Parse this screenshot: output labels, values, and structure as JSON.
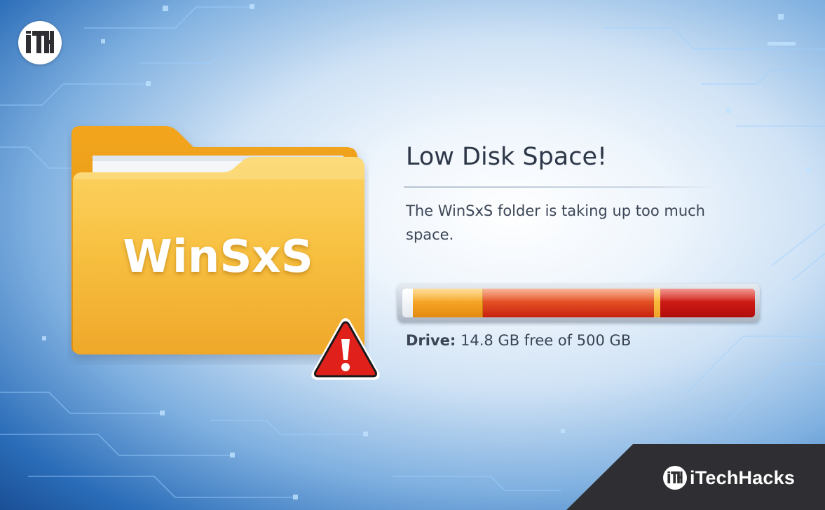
{
  "logo": {
    "mark_text": "iTH"
  },
  "folder": {
    "label": "WinSxS",
    "icon": "folder-icon",
    "warning_icon": "warning-triangle-icon"
  },
  "panel": {
    "title": "Low Disk Space!",
    "description": "The WinSxS folder is taking up too much space.",
    "drive_label": "Drive:",
    "drive_text": "14.8 GB free of 500 GB"
  },
  "disk_usage": {
    "free_gb": 14.8,
    "total_gb": 500,
    "used_fraction": 0.97,
    "colors": {
      "free": "#ffffff",
      "warning": "#f3a021",
      "critical": "#e24d22",
      "danger": "#cc1a14"
    }
  },
  "brand": {
    "name": "iTechHacks",
    "mark_text": "iTH",
    "corner_color": "#2f2f33"
  },
  "theme": {
    "folder_color": "#f6b42c",
    "warning_color": "#e0211b"
  }
}
